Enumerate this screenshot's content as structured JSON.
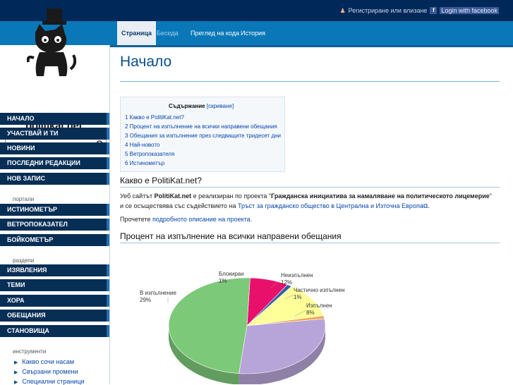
{
  "topbar": {
    "login_label": "Регистриране или влизане",
    "facebook_label": "Login with facebook",
    "facebook_icon": "f"
  },
  "tabs": [
    {
      "label": "Страница",
      "state": "active"
    },
    {
      "label": "Беседа",
      "state": "dim"
    },
    {
      "label": "Преглед на кода",
      "state": "normal"
    },
    {
      "label": "История",
      "state": "normal"
    }
  ],
  "logo": {
    "text": "politikat.net"
  },
  "search": {
    "placeholder": ""
  },
  "sidebar": {
    "nav_main": [
      "НАЧАЛО",
      "УЧАСТВАЙ И ТИ",
      "НОВИНИ",
      "ПОСЛЕДНИ РЕДАКЦИИ",
      "НОВ ЗАПИС"
    ],
    "portals_label": "портали",
    "nav_portals": [
      "ИСТИНОМЕТЪР",
      "ВЕТРОПОКАЗАТЕЛ",
      "БОЙКОМЕТЪР"
    ],
    "sections_label": "раздели",
    "nav_sections": [
      "ИЗЯВЛЕНИЯ",
      "ТЕМИ",
      "ХОРА",
      "ОБЕЩАНИЯ",
      "СТАНОВИЩА"
    ],
    "tools_label": "инструменти",
    "tools": [
      "Какво сочи насам",
      "Свързани промени",
      "Специални страници"
    ]
  },
  "page": {
    "title": "Начало",
    "toc": {
      "heading": "Съдържание",
      "toggle": "скриване",
      "items": [
        "1 Какво е PolitiKat.net?",
        "2 Процент на изпълнение на всички направени обещания",
        "3 Обещания за изпълнение през следващите тридесет дни",
        "4 Най-новото",
        "5 Ветропоказателя",
        "6 Истинометър"
      ]
    },
    "section1_title": "Какво е PolitiKat.net?",
    "p1_pre": "Уеб сайтът ",
    "p1_site": "PolitiKat.net",
    "p1_mid": " е реализиран по проекта \"",
    "p1_project": "Гражданска инициатива за намаляване на политическото лицемерие",
    "p1_mid2": "\" и се осъществява със съдействието на ",
    "p1_link": "Тръст за гражданско общество в Централна и Източна Европа",
    "p1_end": ".",
    "p2_pre": "Прочетете ",
    "p2_link": "подробното описание на проекта",
    "p2_end": ".",
    "section2_title": "Процент на изпълнение на всички направени обещания"
  },
  "chart_data": {
    "type": "pie",
    "categories": [
      "Изпълнен",
      "Частично изпълнен",
      "Неизпълнен",
      "Блокиран",
      "В изпълнение",
      ""
    ],
    "values": [
      8,
      1,
      12,
      1,
      29,
      49
    ],
    "labels": [
      "Изпълнен\n8%",
      "Частично изпълнен\n1%",
      "Неизпълнен\n12%",
      "Блокиран\n1%",
      "В изпълнение\n29%",
      ""
    ],
    "colors": [
      "#e8106a",
      "#2e5fa8",
      "#ffff99",
      "#f5a54a",
      "#b7a4d8",
      "#7dc97a"
    ]
  }
}
